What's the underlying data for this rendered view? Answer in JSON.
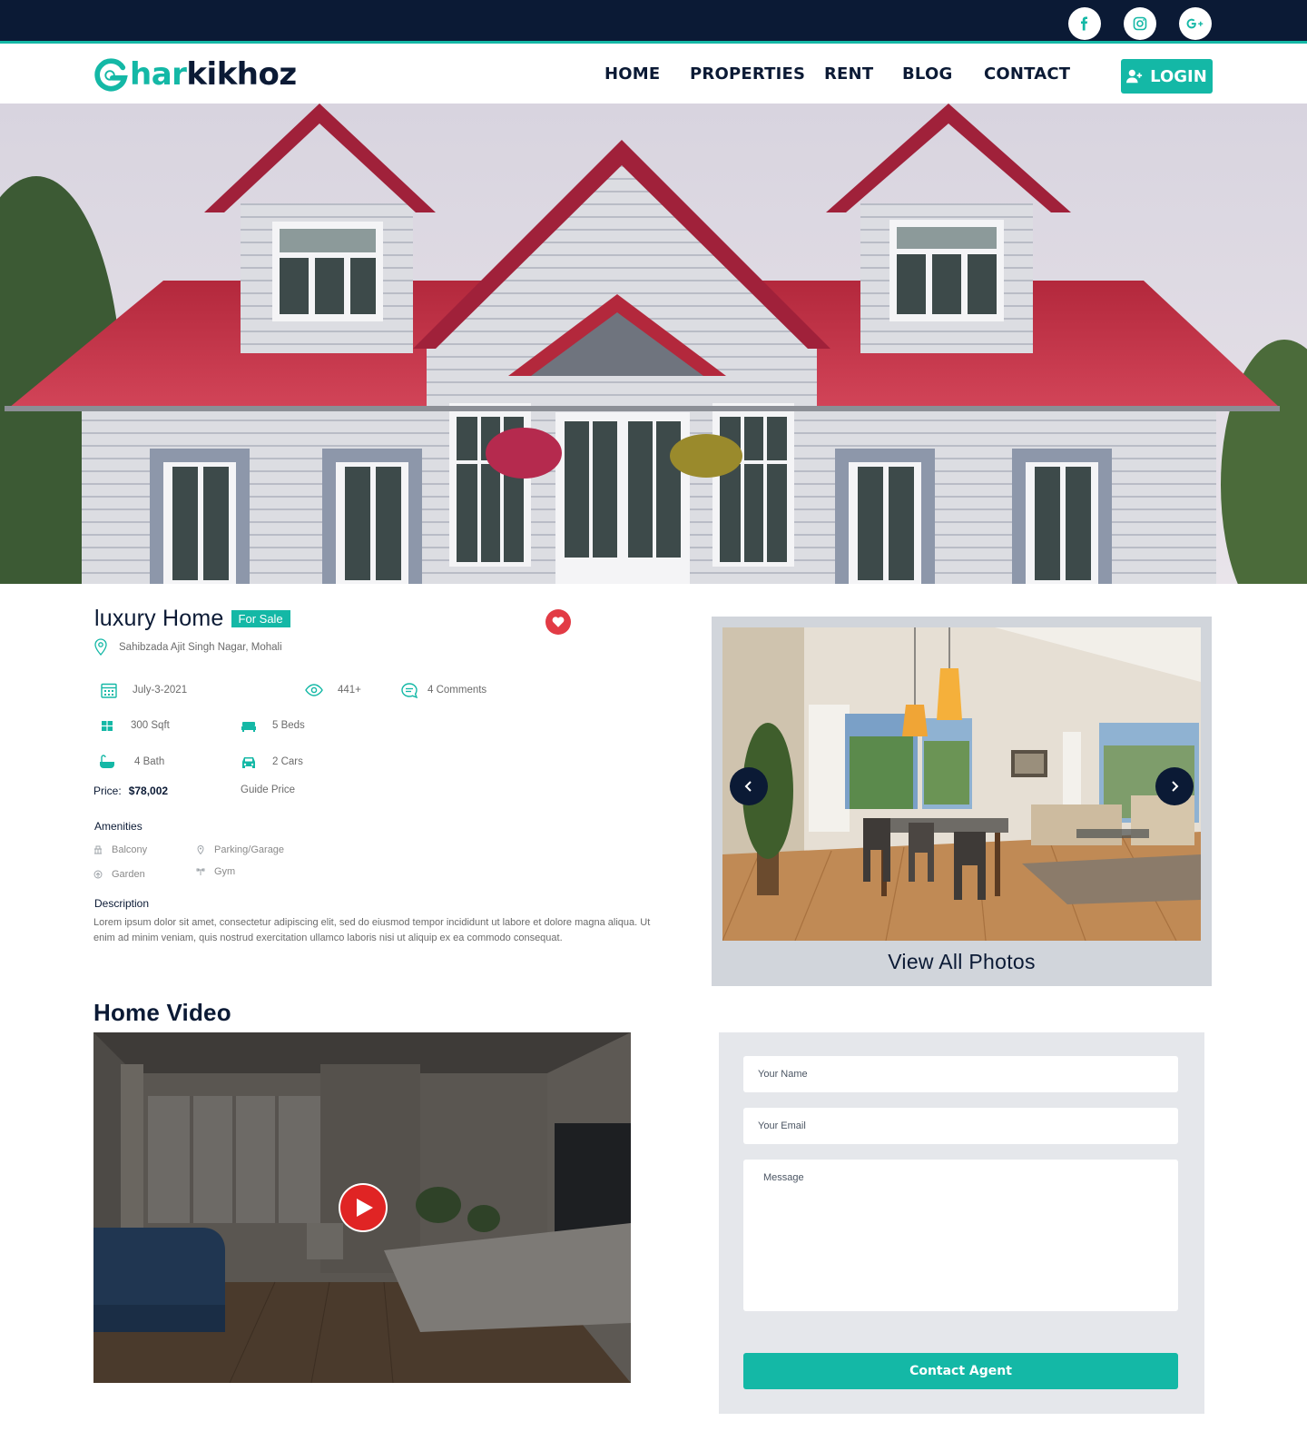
{
  "brand": {
    "logo_teal": "har",
    "logo_dark": "kikhoz",
    "accent_color": "#14b8a6",
    "navy_color": "#0b1a35"
  },
  "social": [
    {
      "icon": "facebook-icon"
    },
    {
      "icon": "instagram-icon"
    },
    {
      "icon": "google-plus-icon"
    }
  ],
  "nav": {
    "items": [
      "HOME",
      "PROPERTIES",
      "RENT",
      "BLOG",
      "CONTACT"
    ],
    "login_label": "LOGIN"
  },
  "property": {
    "title": "luxury Home",
    "badge": "For Sale",
    "address": "Sahibzada Ajit Singh Nagar, Mohali",
    "date": "July-3-2021",
    "views": "441+",
    "comments": "4  Comments",
    "area": "300 Sqft",
    "beds": "5 Beds",
    "baths": "4 Bath",
    "cars": "2 Cars",
    "price_label": "Price:",
    "price_value": "$78,002",
    "price_note": "Guide Price",
    "amenities_title": "Amenities",
    "amenities": [
      "Balcony",
      "Parking/Garage",
      "Garden",
      "Gym"
    ],
    "description_title": "Description",
    "description": "Lorem ipsum dolor sit amet, consectetur adipiscing elit, sed do eiusmod tempor incididunt ut labore et dolore magna aliqua. Ut enim ad minim veniam, quis nostrud exercitation ullamco laboris nisi ut aliquip ex ea commodo consequat."
  },
  "gallery": {
    "view_all_label": "View All Photos"
  },
  "video": {
    "title": "Home Video"
  },
  "contact_form": {
    "name_placeholder": "Your Name",
    "email_placeholder": "Your Email",
    "message_placeholder": "Message",
    "submit_label": "Contact Agent"
  }
}
